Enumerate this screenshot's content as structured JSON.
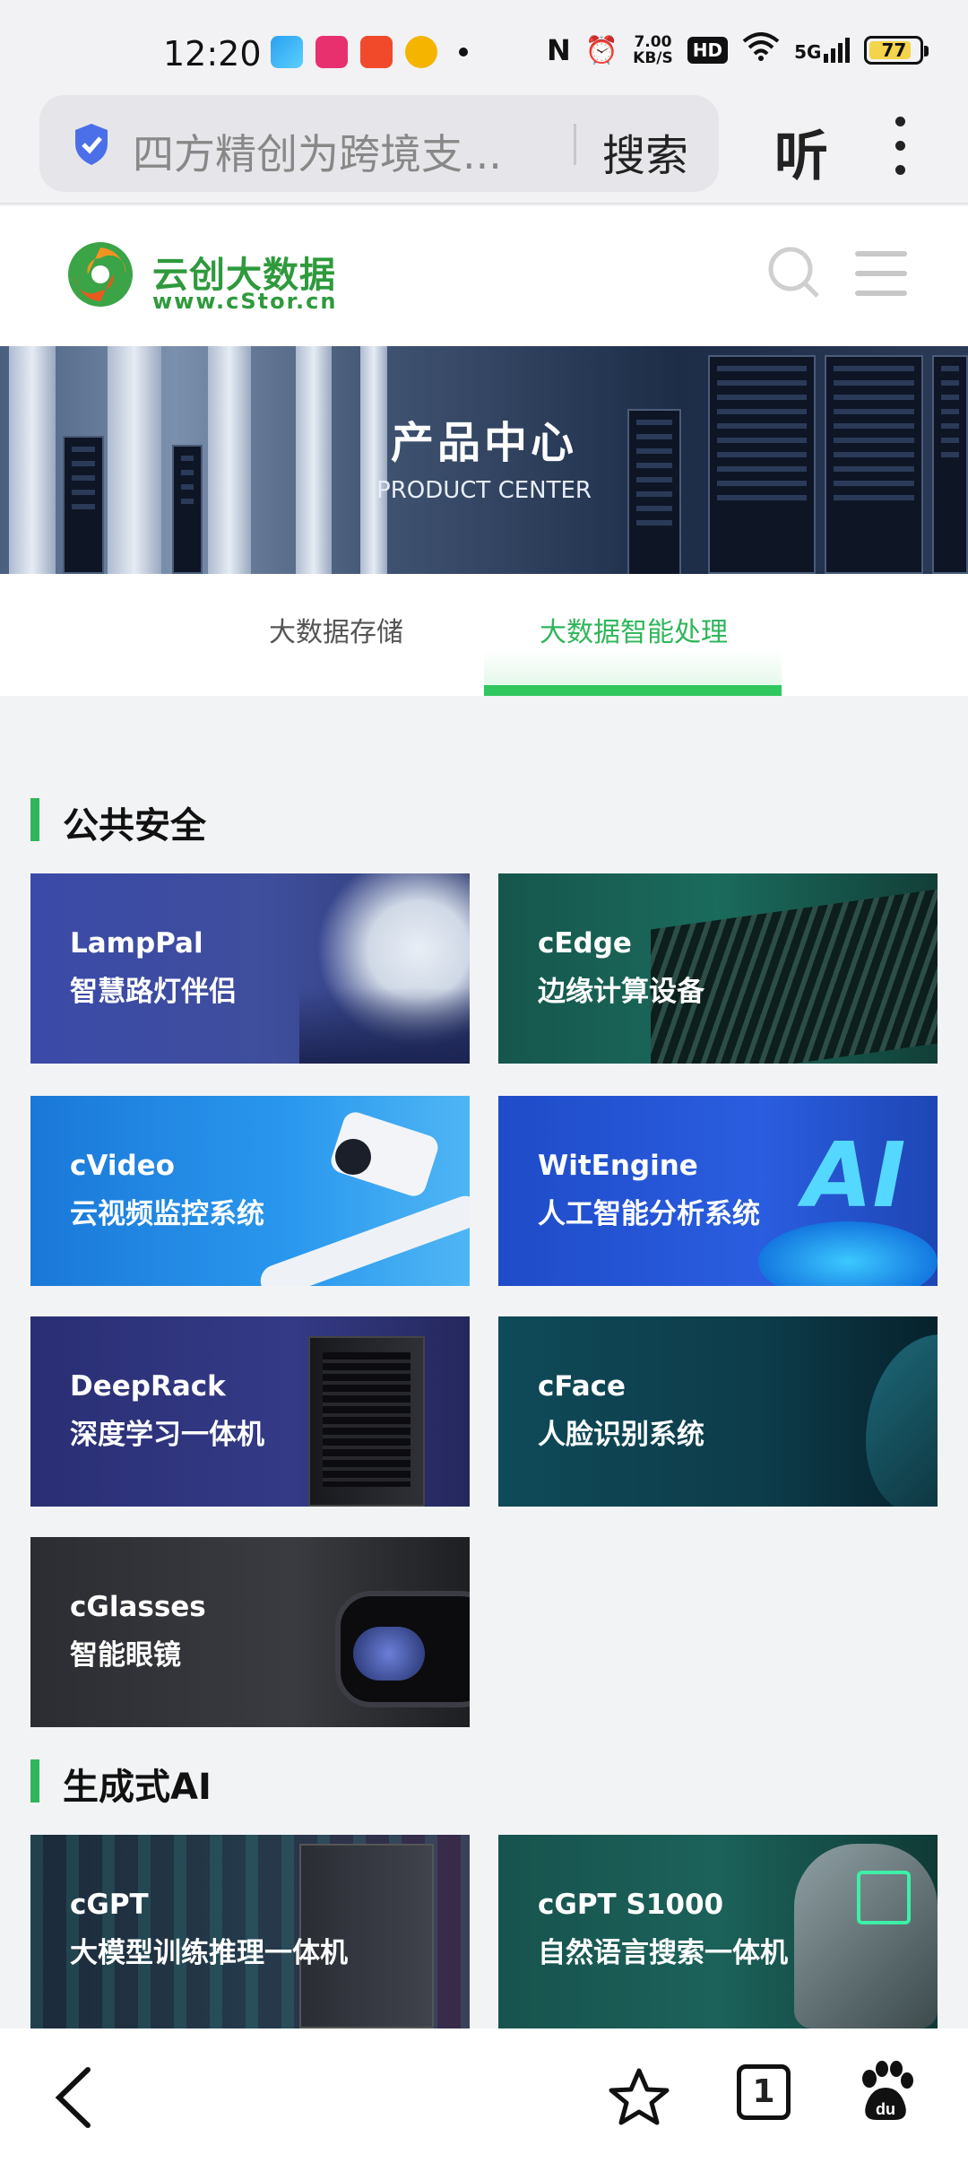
{
  "status_bar": {
    "time": "12:20",
    "net_speed": "7.00",
    "net_speed_unit": "KB/S",
    "hd": "HD",
    "network": "5G",
    "battery": "77",
    "apps": [
      "telegram-icon",
      "pinduoduo-icon",
      "video-play-icon",
      "weibo-icon"
    ]
  },
  "address_bar": {
    "query": "四方精创为跨境支...",
    "search_label": "搜索",
    "listen_label": "听"
  },
  "site": {
    "logo_cn": "云创大数据",
    "logo_url": "www.cStor.cn"
  },
  "banner": {
    "title": "产品中心",
    "subtitle": "PRODUCT CENTER"
  },
  "tabs": [
    {
      "label": "大数据存储",
      "active": false
    },
    {
      "label": "大数据智能处理",
      "active": true
    }
  ],
  "sections": [
    {
      "title": "公共安全",
      "products": [
        {
          "en": "LampPal",
          "cn": "智慧路灯伴侣"
        },
        {
          "en": "cEdge",
          "cn": "边缘计算设备"
        },
        {
          "en": "cVideo",
          "cn": "云视频监控系统"
        },
        {
          "en": "WitEngine",
          "cn": "人工智能分析系统"
        },
        {
          "en": "DeepRack",
          "cn": "深度学习一体机"
        },
        {
          "en": "cFace",
          "cn": "人脸识别系统"
        },
        {
          "en": "cGlasses",
          "cn": "智能眼镜"
        }
      ]
    },
    {
      "title": "生成式AI",
      "products": [
        {
          "en": "cGPT",
          "cn": "大模型训练推理一体机"
        },
        {
          "en": "cGPT S1000",
          "cn": "自然语言搜索一体机"
        }
      ]
    }
  ],
  "navbar": {
    "tab_count": "1"
  },
  "colors": {
    "accent": "#2fb65a",
    "brand": "#2e9a3c"
  }
}
